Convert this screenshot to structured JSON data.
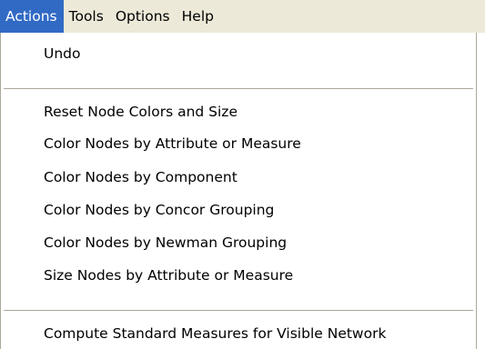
{
  "menubar": {
    "items": [
      {
        "label": "Actions",
        "active": true
      },
      {
        "label": "Tools"
      },
      {
        "label": "Options"
      },
      {
        "label": "Help"
      }
    ]
  },
  "dropdown": {
    "items": [
      {
        "label": "Undo"
      },
      {
        "label": "Reset Node Colors and Size"
      },
      {
        "label": "Color Nodes by Attribute or Measure"
      },
      {
        "label": "Color Nodes by Component"
      },
      {
        "label": "Color Nodes by Concor Grouping"
      },
      {
        "label": "Color Nodes by Newman Grouping"
      },
      {
        "label": "Size Nodes by Attribute or Measure"
      },
      {
        "label": "Compute Standard Measures for Visible Network"
      }
    ]
  },
  "colors": {
    "menubar_bg": "#ece9d8",
    "highlight_bg": "#316ac5",
    "highlight_text": "#ffffff",
    "separator": "#aca899"
  }
}
